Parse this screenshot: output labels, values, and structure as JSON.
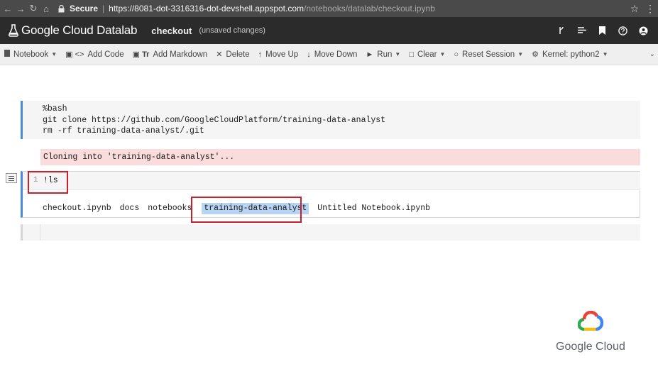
{
  "browser": {
    "secure_label": "Secure",
    "url_host": "https://8081-dot-3316316-dot-devshell.appspot.com",
    "url_path": "/notebooks/datalab/checkout.ipynb"
  },
  "app": {
    "name": "Google Cloud Datalab",
    "notebook_title": "checkout",
    "notebook_status": "(unsaved changes)"
  },
  "toolbar": {
    "notebook_label": "Notebook",
    "add_code_label": "Add Code",
    "add_markdown_label": "Add Markdown",
    "delete_label": "Delete",
    "move_up_label": "Move Up",
    "move_down_label": "Move Down",
    "run_label": "Run",
    "clear_label": "Clear",
    "reset_session_label": "Reset Session",
    "kernel_label": "Kernel: python2"
  },
  "cells": {
    "cell1": {
      "line1": "%bash",
      "line2": "git clone https://github.com/GoogleCloudPlatform/training-data-analyst",
      "line3": "rm -rf training-data-analyst/.git"
    },
    "cell1_output": "Cloning into 'training-data-analyst'...",
    "cell2": {
      "line_number": "1",
      "code": "!ls",
      "output_items": [
        "checkout.ipynb",
        "docs",
        "notebooks",
        "training-data-analyst",
        "Untitled Notebook.ipynb"
      ]
    }
  },
  "watermark": {
    "text": "Google Cloud"
  },
  "colors": {
    "annotation_red": "#cc1f2b",
    "cell_active_border": "#4a8ad8",
    "error_output_bg": "#fbdcdc",
    "selection_bg": "#b9d4f2",
    "appbar_bg": "#2b2b2b"
  },
  "icons": {
    "browser": [
      "back-icon",
      "forward-icon",
      "reload-icon",
      "home-icon",
      "lock-icon",
      "star-icon",
      "more-icon"
    ],
    "appbar": [
      "branch-icon",
      "list-icon",
      "bookmark-icon",
      "help-icon",
      "account-icon"
    ]
  }
}
